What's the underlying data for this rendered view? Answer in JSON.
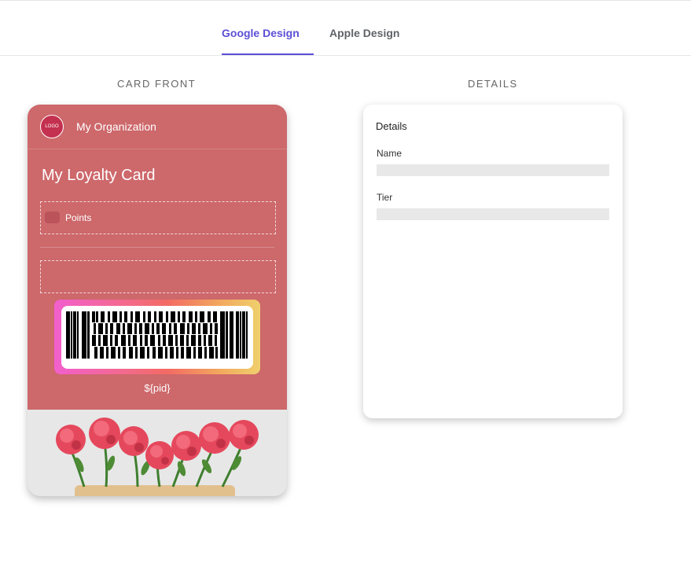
{
  "tabs": [
    {
      "label": "Google Design",
      "active": true
    },
    {
      "label": "Apple Design",
      "active": false
    }
  ],
  "sections": {
    "front_label": "CARD FRONT",
    "details_label": "DETAILS"
  },
  "card": {
    "logo_text": "LOGO",
    "org_name": "My Organization",
    "title": "My Loyalty Card",
    "points_label": "Points",
    "barcode_value": "${pid}",
    "background_color": "#cd686b",
    "logo_color": "#c4304f"
  },
  "details": {
    "title": "Details",
    "fields": [
      {
        "label": "Name"
      },
      {
        "label": "Tier"
      }
    ]
  },
  "colors": {
    "accent": "#5b4fd6"
  }
}
